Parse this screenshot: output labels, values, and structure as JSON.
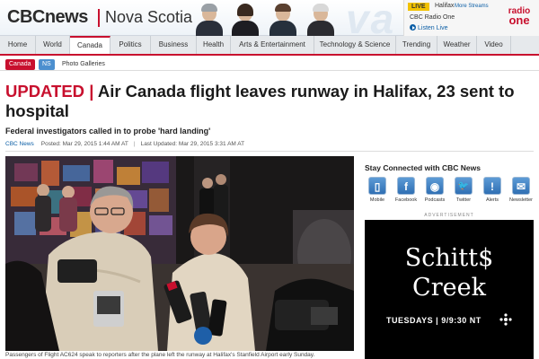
{
  "header": {
    "logo": "CBCnews",
    "region": "Nova Scotia",
    "hosts": [
      "host-1",
      "host-2",
      "host-3",
      "host-4"
    ],
    "live": {
      "tag": "LIVE",
      "city": "Halifax",
      "more": "More Streams",
      "station": "CBC Radio One",
      "listen": "Listen Live",
      "brand_line1": "radio",
      "brand_line2": "one"
    }
  },
  "nav": {
    "items": [
      {
        "label": "Home"
      },
      {
        "label": "World"
      },
      {
        "label": "Canada",
        "active": true
      },
      {
        "label": "Politics"
      },
      {
        "label": "Business"
      },
      {
        "label": "Health"
      },
      {
        "label": "Arts & Entertainment"
      },
      {
        "label": "Technology & Science"
      },
      {
        "label": "Trending"
      },
      {
        "label": "Weather"
      },
      {
        "label": "Video"
      }
    ]
  },
  "subnav": {
    "crumb1": "Canada",
    "crumb2": "NS",
    "link": "Photo Galleries"
  },
  "article": {
    "updated": "UPDATED",
    "separator": "|",
    "title": "Air Canada flight leaves runway in Halifax, 23 sent to hospital",
    "subhead": "Federal investigators called in to probe 'hard landing'",
    "source": "CBC News",
    "posted": "Posted: Mar 29, 2015 1:44 AM AT",
    "separator2": "|",
    "updated_time": "Last Updated: Mar 29, 2015 3:31 AM AT",
    "caption": "Passengers of Flight AC624 speak to reporters after the plane left the runway at Halifax's Stanfield Airport early Sunday."
  },
  "sidebar": {
    "stay_title": "Stay Connected with CBC News",
    "social": [
      {
        "label": "Mobile",
        "icon": "mobile-icon",
        "glyph": "▯"
      },
      {
        "label": "Facebook",
        "icon": "facebook-icon",
        "glyph": "f"
      },
      {
        "label": "Podcasts",
        "icon": "podcast-icon",
        "glyph": "◉"
      },
      {
        "label": "Twitter",
        "icon": "twitter-icon",
        "glyph": "🐦"
      },
      {
        "label": "Alerts",
        "icon": "alert-icon",
        "glyph": "!"
      },
      {
        "label": "Newsletter",
        "icon": "newsletter-icon",
        "glyph": "✉"
      }
    ],
    "ad_label": "ADVERTISEMENT",
    "ad": {
      "title1": "Schitt$",
      "title2": "Creek",
      "when": "TUESDAYS | 9/9:30 NT"
    }
  },
  "colors": {
    "cbc_red": "#c8102e",
    "link_blue": "#0c5fa6",
    "live_yellow": "#f2c200",
    "nav_bg": "#e6e9ec"
  }
}
